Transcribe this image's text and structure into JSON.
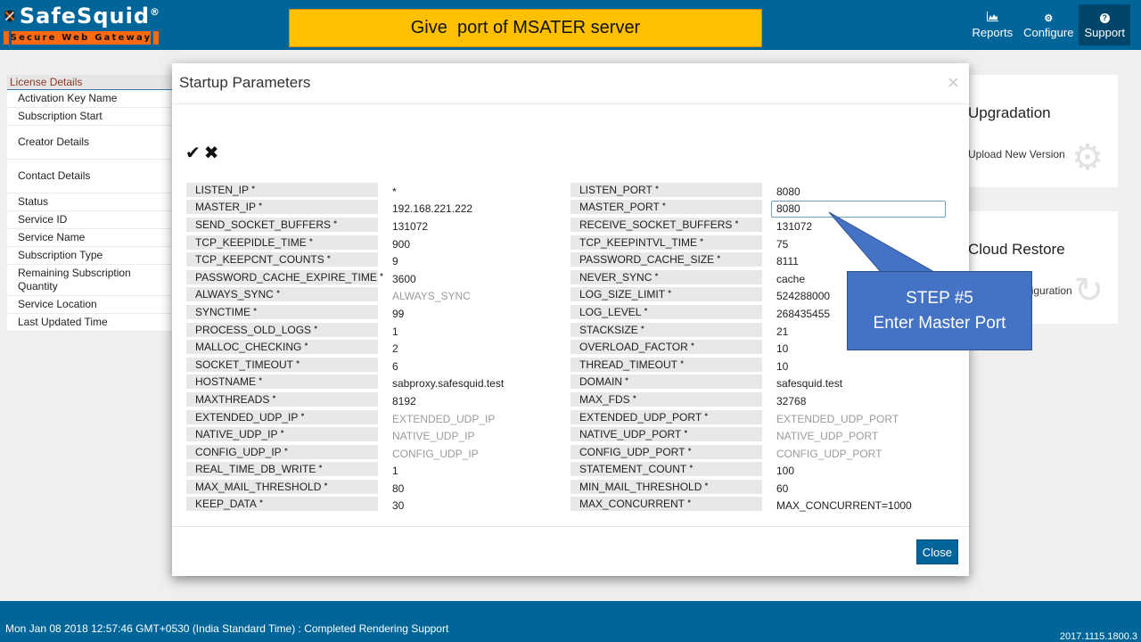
{
  "header": {
    "logo_text": "SafeSquid",
    "logo_reg": "®",
    "logo_tagline": "Secure Web Gateway",
    "banner_text": "Give  port of MSATER server",
    "nav": [
      {
        "label": "Reports",
        "icon": "chart-icon",
        "glyph": "▟"
      },
      {
        "label": "Configure",
        "icon": "cogs-icon",
        "glyph": "⚙"
      },
      {
        "label": "Support",
        "icon": "question-icon",
        "glyph": "?",
        "active": true
      }
    ]
  },
  "sidebar": {
    "heading": "License Details",
    "items": [
      {
        "label": "Activation Key Name"
      },
      {
        "label": "Subscription Start"
      },
      {
        "label": "Creator Details"
      },
      {
        "label": "Contact Details"
      },
      {
        "label": "Status"
      },
      {
        "label": "Service ID"
      },
      {
        "label": "Service Name"
      },
      {
        "label": "Subscription Type"
      },
      {
        "label": "Remaining Subscription Quantity"
      },
      {
        "label": "Service Location"
      },
      {
        "label": "Last Updated Time"
      }
    ]
  },
  "cards": {
    "upgradation": {
      "title": "Upgradation",
      "subtitle": "Upload New Version"
    },
    "cloud_restore": {
      "title": "Cloud Restore",
      "subtitle": "Restore Configuration"
    }
  },
  "modal": {
    "title": "Startup Parameters",
    "close_glyph": "×",
    "save_glyph": "✔",
    "cancel_glyph": "✖",
    "close_button": "Close",
    "left_params": [
      {
        "name": "LISTEN_IP",
        "value": "*"
      },
      {
        "name": "MASTER_IP",
        "value": "192.168.221.222"
      },
      {
        "name": "SEND_SOCKET_BUFFERS",
        "value": "131072"
      },
      {
        "name": "TCP_KEEPIDLE_TIME",
        "value": "900"
      },
      {
        "name": "TCP_KEEPCNT_COUNTS",
        "value": "9"
      },
      {
        "name": "PASSWORD_CACHE_EXPIRE_TIME",
        "value": "3600"
      },
      {
        "name": "ALWAYS_SYNC",
        "value": "ALWAYS_SYNC",
        "placeholder": true
      },
      {
        "name": "SYNCTIME",
        "value": "99"
      },
      {
        "name": "PROCESS_OLD_LOGS",
        "value": "1"
      },
      {
        "name": "MALLOC_CHECKING",
        "value": "2"
      },
      {
        "name": "SOCKET_TIMEOUT",
        "value": "6"
      },
      {
        "name": "HOSTNAME",
        "value": "sabproxy.safesquid.test"
      },
      {
        "name": "MAXTHREADS",
        "value": "8192"
      },
      {
        "name": "EXTENDED_UDP_IP",
        "value": "EXTENDED_UDP_IP",
        "placeholder": true
      },
      {
        "name": "NATIVE_UDP_IP",
        "value": "NATIVE_UDP_IP",
        "placeholder": true
      },
      {
        "name": "CONFIG_UDP_IP",
        "value": "CONFIG_UDP_IP",
        "placeholder": true
      },
      {
        "name": "REAL_TIME_DB_WRITE",
        "value": "1"
      },
      {
        "name": "MAX_MAIL_THRESHOLD",
        "value": "80"
      },
      {
        "name": "KEEP_DATA",
        "value": "30"
      }
    ],
    "right_params": [
      {
        "name": "LISTEN_PORT",
        "value": "8080"
      },
      {
        "name": "MASTER_PORT",
        "value": "8080",
        "editing": true
      },
      {
        "name": "RECEIVE_SOCKET_BUFFERS",
        "value": "131072"
      },
      {
        "name": "TCP_KEEPINTVL_TIME",
        "value": "75"
      },
      {
        "name": "PASSWORD_CACHE_SIZE",
        "value": "8111"
      },
      {
        "name": "NEVER_SYNC",
        "value": "cache"
      },
      {
        "name": "LOG_SIZE_LIMIT",
        "value": "524288000"
      },
      {
        "name": "LOG_LEVEL",
        "value": "268435455"
      },
      {
        "name": "STACKSIZE",
        "value": "21"
      },
      {
        "name": "OVERLOAD_FACTOR",
        "value": "10"
      },
      {
        "name": "THREAD_TIMEOUT",
        "value": "10"
      },
      {
        "name": "DOMAIN",
        "value": "safesquid.test"
      },
      {
        "name": "MAX_FDS",
        "value": "32768"
      },
      {
        "name": "EXTENDED_UDP_PORT",
        "value": "EXTENDED_UDP_PORT",
        "placeholder": true
      },
      {
        "name": "NATIVE_UDP_PORT",
        "value": "NATIVE_UDP_PORT",
        "placeholder": true
      },
      {
        "name": "CONFIG_UDP_PORT",
        "value": "CONFIG_UDP_PORT",
        "placeholder": true
      },
      {
        "name": "STATEMENT_COUNT",
        "value": "100"
      },
      {
        "name": "MIN_MAIL_THRESHOLD",
        "value": "60"
      },
      {
        "name": "MAX_CONCURRENT",
        "value": "MAX_CONCURRENT=1000"
      }
    ]
  },
  "callout": {
    "line1": "STEP #5",
    "line2": "Enter Master Port"
  },
  "footer": {
    "status": "Mon Jan 08 2018 12:57:46 GMT+0530 (India Standard Time) : Completed Rendering Support",
    "version": "2017.1115.1800.3"
  },
  "colors": {
    "brand_blue": "#006699",
    "banner_yellow": "#ffc000",
    "callout_blue": "#4472c4",
    "logo_orange": "#ff6a13"
  }
}
